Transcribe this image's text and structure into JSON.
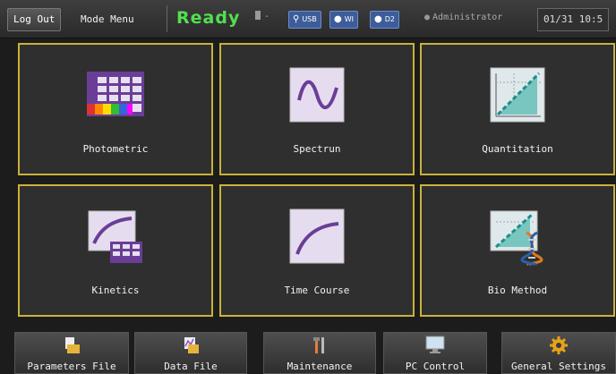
{
  "topbar": {
    "logout_label": "Log Out",
    "mode_menu_label": "Mode Menu",
    "status": "Ready",
    "battery_text": "-",
    "usb_label": "USB",
    "wi_label": "WI",
    "d2_label": "D2",
    "user": "Administrator",
    "clock": "01/31 10:5"
  },
  "tiles": [
    {
      "label": "Photometric",
      "icon": "photometric-grid-icon"
    },
    {
      "label": "Spectrun",
      "icon": "spectrum-wave-icon"
    },
    {
      "label": "Quantitation",
      "icon": "quantitation-line-icon"
    },
    {
      "label": "Kinetics",
      "icon": "kinetics-curve-icon"
    },
    {
      "label": "Time Course",
      "icon": "time-course-curve-icon"
    },
    {
      "label": "Bio Method",
      "icon": "dna-icon"
    }
  ],
  "bottom": [
    {
      "label": "Parameters File",
      "icon": "parameters-file-icon"
    },
    {
      "label": "Data File",
      "icon": "data-file-icon"
    },
    {
      "label": "Maintenance",
      "icon": "maintenance-tools-icon"
    },
    {
      "label": "PC Control",
      "icon": "monitor-icon"
    },
    {
      "label": "General Settings",
      "icon": "gear-icon"
    }
  ],
  "colors": {
    "tile_border": "#c9b23a",
    "status_green": "#52e04e",
    "chip_blue": "#3d5d9a"
  }
}
